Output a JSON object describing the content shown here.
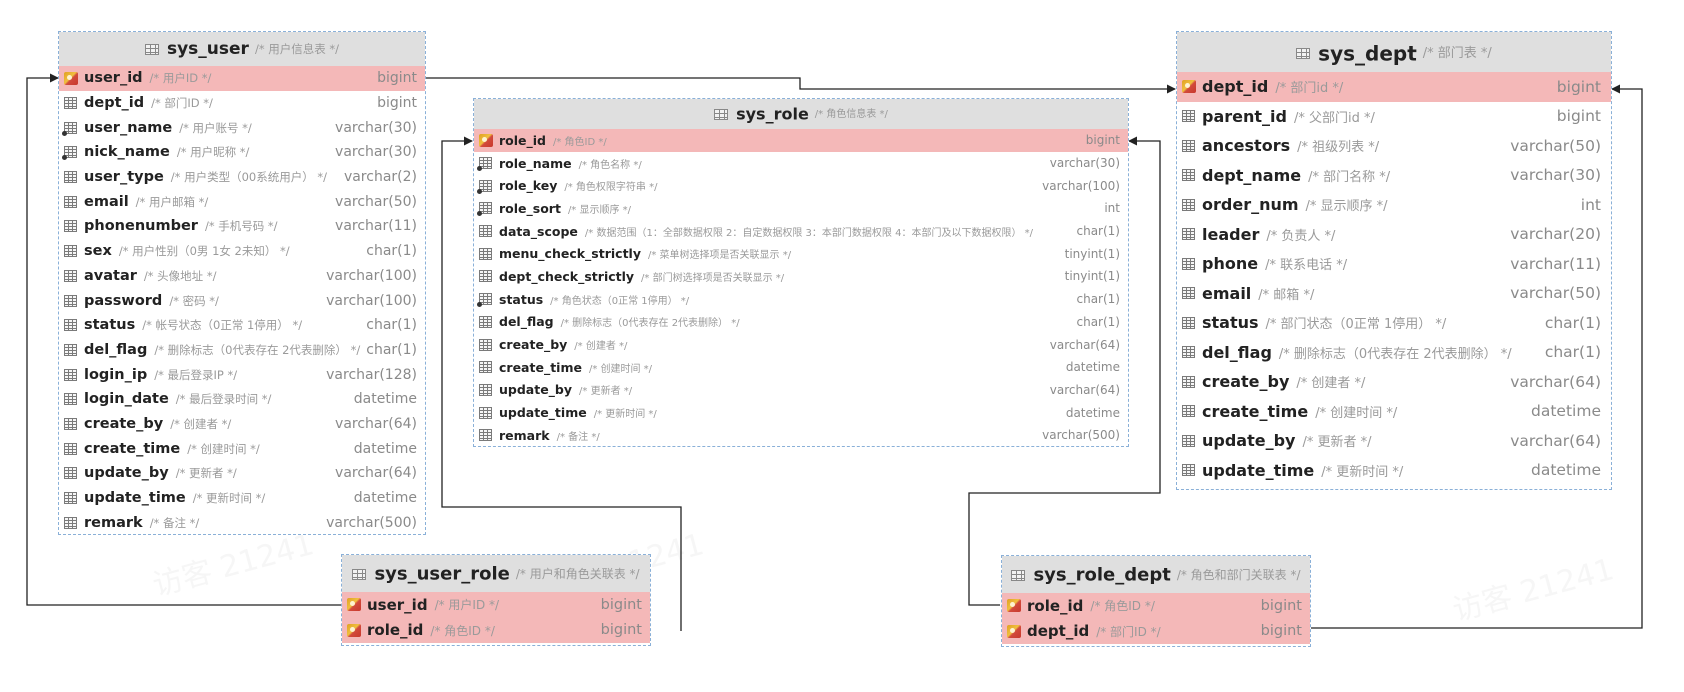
{
  "watermark": "访客 21241",
  "tables": {
    "sys_user": {
      "name": "sys_user",
      "comment": "/* 用户信息表 */",
      "columns": [
        {
          "name": "user_id",
          "comment": "/* 用户ID */",
          "type": "bigint",
          "pk": true,
          "nn": true
        },
        {
          "name": "dept_id",
          "comment": "/* 部门ID */",
          "type": "bigint",
          "pk": false,
          "nn": false
        },
        {
          "name": "user_name",
          "comment": "/* 用户账号 */",
          "type": "varchar(30)",
          "pk": false,
          "nn": true
        },
        {
          "name": "nick_name",
          "comment": "/* 用户昵称 */",
          "type": "varchar(30)",
          "pk": false,
          "nn": true
        },
        {
          "name": "user_type",
          "comment": "/* 用户类型（00系统用户） */",
          "type": "varchar(2)",
          "pk": false,
          "nn": false
        },
        {
          "name": "email",
          "comment": "/* 用户邮箱 */",
          "type": "varchar(50)",
          "pk": false,
          "nn": false
        },
        {
          "name": "phonenumber",
          "comment": "/* 手机号码 */",
          "type": "varchar(11)",
          "pk": false,
          "nn": false
        },
        {
          "name": "sex",
          "comment": "/* 用户性别（0男 1女 2未知） */",
          "type": "char(1)",
          "pk": false,
          "nn": false
        },
        {
          "name": "avatar",
          "comment": "/* 头像地址 */",
          "type": "varchar(100)",
          "pk": false,
          "nn": false
        },
        {
          "name": "password",
          "comment": "/* 密码 */",
          "type": "varchar(100)",
          "pk": false,
          "nn": false
        },
        {
          "name": "status",
          "comment": "/* 帐号状态（0正常 1停用） */",
          "type": "char(1)",
          "pk": false,
          "nn": false
        },
        {
          "name": "del_flag",
          "comment": "/* 删除标志（0代表存在 2代表删除） */",
          "type": "char(1)",
          "pk": false,
          "nn": false
        },
        {
          "name": "login_ip",
          "comment": "/* 最后登录IP */",
          "type": "varchar(128)",
          "pk": false,
          "nn": false
        },
        {
          "name": "login_date",
          "comment": "/* 最后登录时间 */",
          "type": "datetime",
          "pk": false,
          "nn": false
        },
        {
          "name": "create_by",
          "comment": "/* 创建者 */",
          "type": "varchar(64)",
          "pk": false,
          "nn": false
        },
        {
          "name": "create_time",
          "comment": "/* 创建时间 */",
          "type": "datetime",
          "pk": false,
          "nn": false
        },
        {
          "name": "update_by",
          "comment": "/* 更新者 */",
          "type": "varchar(64)",
          "pk": false,
          "nn": false
        },
        {
          "name": "update_time",
          "comment": "/* 更新时间 */",
          "type": "datetime",
          "pk": false,
          "nn": false
        },
        {
          "name": "remark",
          "comment": "/* 备注 */",
          "type": "varchar(500)",
          "pk": false,
          "nn": false
        }
      ]
    },
    "sys_role": {
      "name": "sys_role",
      "comment": "/* 角色信息表 */",
      "columns": [
        {
          "name": "role_id",
          "comment": "/* 角色ID */",
          "type": "bigint",
          "pk": true,
          "nn": true
        },
        {
          "name": "role_name",
          "comment": "/* 角色名称 */",
          "type": "varchar(30)",
          "pk": false,
          "nn": true
        },
        {
          "name": "role_key",
          "comment": "/* 角色权限字符串 */",
          "type": "varchar(100)",
          "pk": false,
          "nn": true
        },
        {
          "name": "role_sort",
          "comment": "/* 显示顺序 */",
          "type": "int",
          "pk": false,
          "nn": true
        },
        {
          "name": "data_scope",
          "comment": "/* 数据范围（1：全部数据权限 2：自定数据权限 3：本部门数据权限 4：本部门及以下数据权限） */",
          "type": "char(1)",
          "pk": false,
          "nn": false
        },
        {
          "name": "menu_check_strictly",
          "comment": "/* 菜单树选择项是否关联显示 */",
          "type": "tinyint(1)",
          "pk": false,
          "nn": false
        },
        {
          "name": "dept_check_strictly",
          "comment": "/* 部门树选择项是否关联显示 */",
          "type": "tinyint(1)",
          "pk": false,
          "nn": false
        },
        {
          "name": "status",
          "comment": "/* 角色状态（0正常 1停用） */",
          "type": "char(1)",
          "pk": false,
          "nn": true
        },
        {
          "name": "del_flag",
          "comment": "/* 删除标志（0代表存在 2代表删除） */",
          "type": "char(1)",
          "pk": false,
          "nn": false
        },
        {
          "name": "create_by",
          "comment": "/* 创建者 */",
          "type": "varchar(64)",
          "pk": false,
          "nn": false
        },
        {
          "name": "create_time",
          "comment": "/* 创建时间 */",
          "type": "datetime",
          "pk": false,
          "nn": false
        },
        {
          "name": "update_by",
          "comment": "/* 更新者 */",
          "type": "varchar(64)",
          "pk": false,
          "nn": false
        },
        {
          "name": "update_time",
          "comment": "/* 更新时间 */",
          "type": "datetime",
          "pk": false,
          "nn": false
        },
        {
          "name": "remark",
          "comment": "/* 备注 */",
          "type": "varchar(500)",
          "pk": false,
          "nn": false
        }
      ]
    },
    "sys_dept": {
      "name": "sys_dept",
      "comment": "/* 部门表 */",
      "columns": [
        {
          "name": "dept_id",
          "comment": "/* 部门id */",
          "type": "bigint",
          "pk": true,
          "nn": true
        },
        {
          "name": "parent_id",
          "comment": "/* 父部门id */",
          "type": "bigint",
          "pk": false,
          "nn": false
        },
        {
          "name": "ancestors",
          "comment": "/* 祖级列表 */",
          "type": "varchar(50)",
          "pk": false,
          "nn": false
        },
        {
          "name": "dept_name",
          "comment": "/* 部门名称 */",
          "type": "varchar(30)",
          "pk": false,
          "nn": false
        },
        {
          "name": "order_num",
          "comment": "/* 显示顺序 */",
          "type": "int",
          "pk": false,
          "nn": false
        },
        {
          "name": "leader",
          "comment": "/* 负责人 */",
          "type": "varchar(20)",
          "pk": false,
          "nn": false
        },
        {
          "name": "phone",
          "comment": "/* 联系电话 */",
          "type": "varchar(11)",
          "pk": false,
          "nn": false
        },
        {
          "name": "email",
          "comment": "/* 邮箱 */",
          "type": "varchar(50)",
          "pk": false,
          "nn": false
        },
        {
          "name": "status",
          "comment": "/* 部门状态（0正常 1停用） */",
          "type": "char(1)",
          "pk": false,
          "nn": false
        },
        {
          "name": "del_flag",
          "comment": "/* 删除标志（0代表存在 2代表删除） */",
          "type": "char(1)",
          "pk": false,
          "nn": false
        },
        {
          "name": "create_by",
          "comment": "/* 创建者 */",
          "type": "varchar(64)",
          "pk": false,
          "nn": false
        },
        {
          "name": "create_time",
          "comment": "/* 创建时间 */",
          "type": "datetime",
          "pk": false,
          "nn": false
        },
        {
          "name": "update_by",
          "comment": "/* 更新者 */",
          "type": "varchar(64)",
          "pk": false,
          "nn": false
        },
        {
          "name": "update_time",
          "comment": "/* 更新时间 */",
          "type": "datetime",
          "pk": false,
          "nn": false
        }
      ]
    },
    "sys_user_role": {
      "name": "sys_user_role",
      "comment": "/* 用户和角色关联表 */",
      "columns": [
        {
          "name": "user_id",
          "comment": "/* 用户ID */",
          "type": "bigint",
          "pk": true,
          "nn": true
        },
        {
          "name": "role_id",
          "comment": "/* 角色ID */",
          "type": "bigint",
          "pk": true,
          "nn": true
        }
      ]
    },
    "sys_role_dept": {
      "name": "sys_role_dept",
      "comment": "/* 角色和部门关联表 */",
      "columns": [
        {
          "name": "role_id",
          "comment": "/* 角色ID */",
          "type": "bigint",
          "pk": true,
          "nn": true
        },
        {
          "name": "dept_id",
          "comment": "/* 部门ID */",
          "type": "bigint",
          "pk": true,
          "nn": true
        }
      ]
    }
  },
  "colors": {
    "header_bg": "#dfdfdf",
    "pk_row_bg": "#f4b8b8",
    "border": "#8ab0d8",
    "link": "#222222"
  }
}
